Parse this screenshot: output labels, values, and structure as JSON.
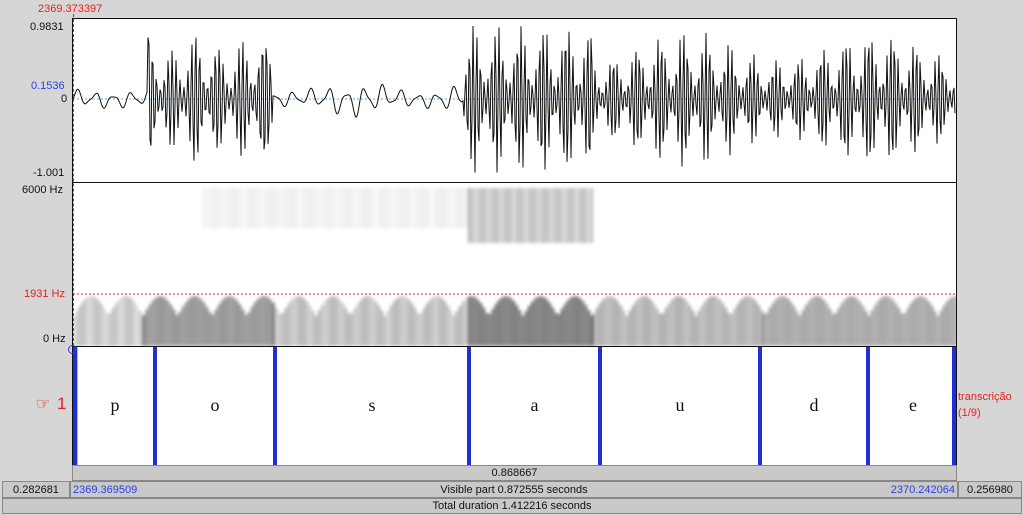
{
  "cursor_time": "2369.373397",
  "waveform": {
    "y_max_label": "0.9831",
    "y_cursor_label": "0.1536",
    "y_zero_label": "0",
    "y_min_label": "-1.001"
  },
  "spectrogram": {
    "top_label": "6000 Hz",
    "cursor_label": "1931 Hz",
    "bottom_label": "0 Hz"
  },
  "textgrid": {
    "tier_number": "1",
    "tier_name": "transcrição",
    "tier_count": "(1/9)",
    "segments": [
      {
        "label": "p"
      },
      {
        "label": "o"
      },
      {
        "label": "s"
      },
      {
        "label": "a"
      },
      {
        "label": "u"
      },
      {
        "label": "d"
      },
      {
        "label": "e"
      }
    ]
  },
  "selection_duration": "0.868667",
  "left_hidden": "0.282681",
  "visible_start": "2369.369509",
  "visible_part": "Visible part 0.872555 seconds",
  "visible_end": "2370.242064",
  "right_hidden": "0.256980",
  "total_duration": "Total duration 1.412216 seconds",
  "colors": {
    "accent_red": "#e8211f",
    "accent_blue": "#2a3ee8",
    "boundary_blue": "#1f2fd6"
  }
}
